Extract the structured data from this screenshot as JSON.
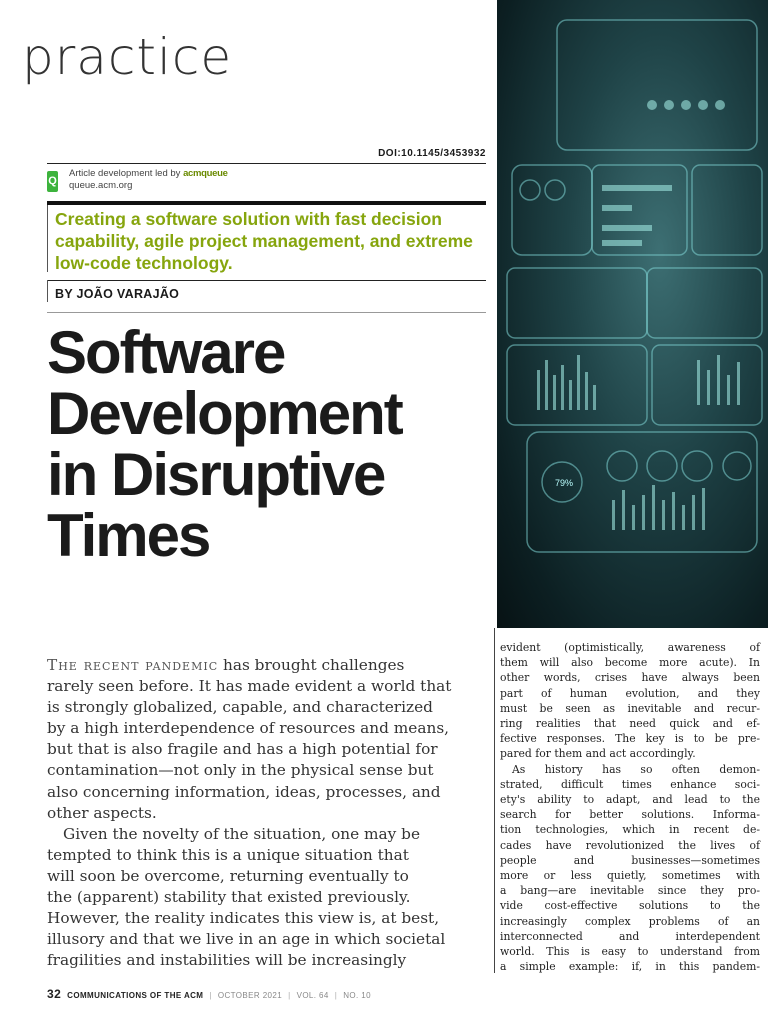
{
  "section": "practice",
  "doi": "DOI:10.1145/3453932",
  "credit": {
    "badge": "Q",
    "line1": "Article development led by ",
    "brand": "acmqueue",
    "line2": "queue.acm.org"
  },
  "deck": "Creating a software solution with fast decision capability, agile project management, and extreme low-code technology.",
  "byline": "BY JOÃO VARAJÃO",
  "title_lines": [
    "Software",
    "Development",
    "in Disruptive",
    "Times"
  ],
  "hero": {
    "gauge_label": "79%"
  },
  "left_body": {
    "lead_in": "The recent pandemic",
    "lines": [
      " has brought challenges",
      "rarely seen before. It has made evident a world that",
      "is strongly globalized, capable, and characterized",
      "by a high interdependence of resources and means,",
      "but that is also fragile and has a high potential for",
      "contamination—not only in the physical sense but",
      "also concerning information, ideas, processes, and",
      "other aspects.",
      "Given the novelty of the situation, one may be",
      "tempted to think this is a unique situation that",
      "will soon be overcome, returning eventually to",
      "the (apparent) stability that existed previously.",
      "However, the reality indicates this view is, at best,",
      "illusory and that we live in an age in which societal",
      "fragilities and instabilities will be increasingly"
    ]
  },
  "right_body": {
    "lines": [
      "evident (optimistically, awareness of",
      "them will also become more acute). In",
      "other words, crises have always been",
      "part of human evolution, and they",
      "must be seen as inevitable and recur-",
      "ring realities that need quick and ef-",
      "fective responses. The key is to be pre-",
      "pared for them and act accordingly.",
      "As history has so often demon-",
      "strated, difficult times enhance soci-",
      "ety's ability to adapt, and lead to the",
      "search for better solutions. Informa-",
      "tion technologies, which in recent de-",
      "cades have revolutionized the lives of",
      "people and businesses—sometimes",
      "more or less quietly, sometimes with",
      "a bang—are inevitable since they pro-",
      "vide cost-effective solutions to the",
      "increasingly complex problems of an",
      "interconnected and interdependent",
      "world. This is easy to understand from",
      "a simple example: if, in this pandem-"
    ]
  },
  "footer": {
    "page": "32",
    "magazine": "COMMUNICATIONS OF THE ACM",
    "date": "OCTOBER 2021",
    "volume": "VOL. 64",
    "number": "NO. 10"
  }
}
